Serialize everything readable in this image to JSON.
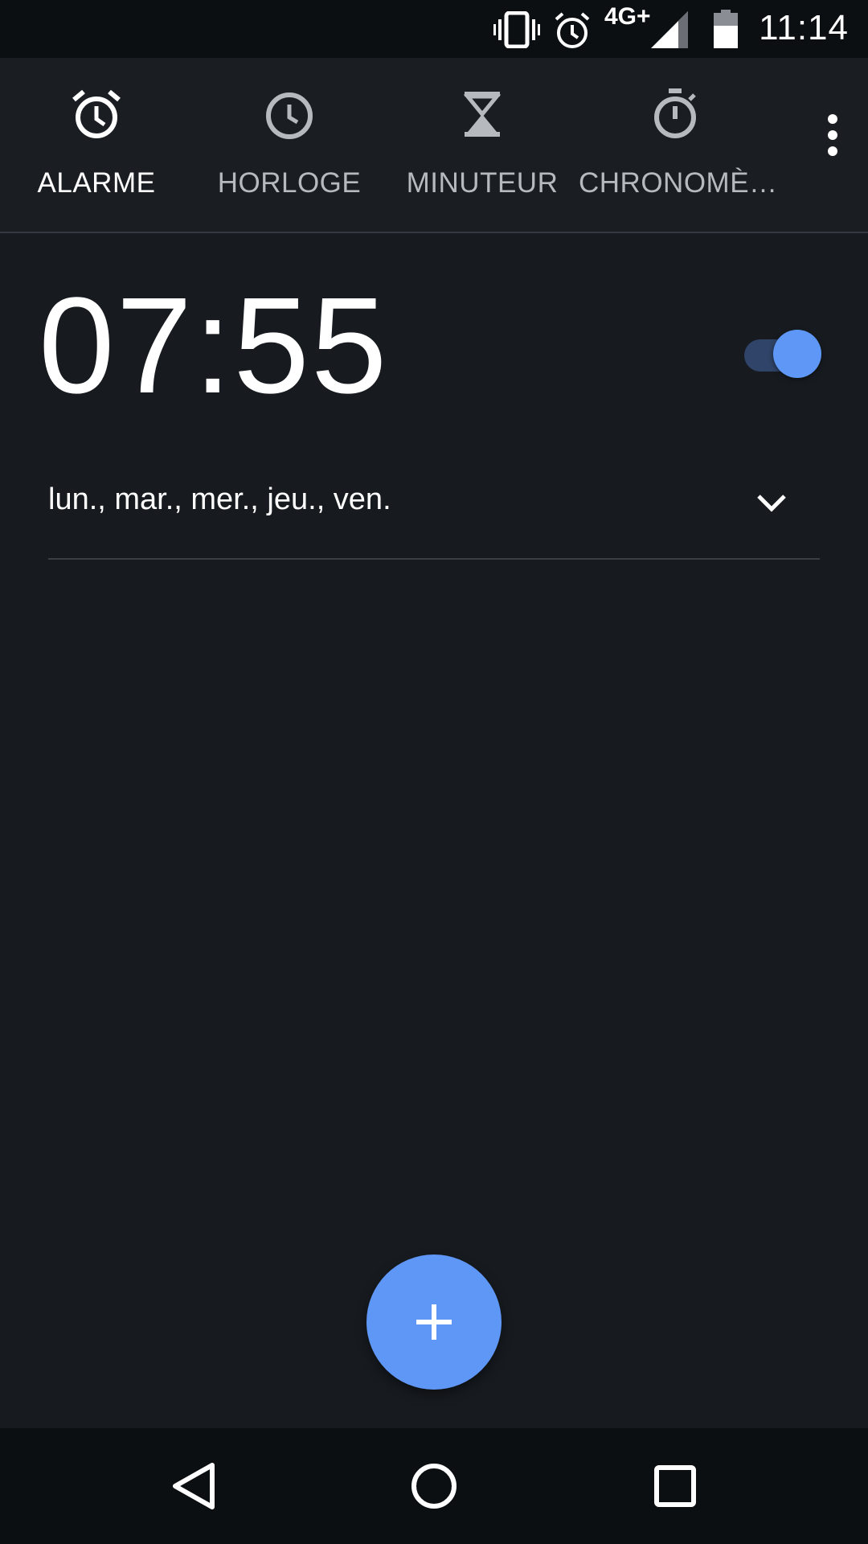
{
  "status_bar": {
    "network": "4G+",
    "time": "11:14",
    "icons": [
      "vibrate-icon",
      "alarm-icon",
      "signal-icon",
      "battery-icon"
    ]
  },
  "tabs": [
    {
      "label": "ALARME",
      "icon": "alarm-clock-icon",
      "active": true
    },
    {
      "label": "HORLOGE",
      "icon": "clock-icon",
      "active": false
    },
    {
      "label": "MINUTEUR",
      "icon": "hourglass-icon",
      "active": false
    },
    {
      "label": "CHRONOMÈ…",
      "icon": "stopwatch-icon",
      "active": false
    }
  ],
  "overflow_icon": "more-vert-icon",
  "alarm": {
    "time": "07:55",
    "enabled": true,
    "days": "lun., mar., mer., jeu., ven."
  },
  "fab_icon": "plus-icon",
  "nav": [
    "back-icon",
    "home-icon",
    "recents-icon"
  ],
  "colors": {
    "background": "#171b20",
    "accent": "#5e97f6",
    "toggle_track": "#2f4468",
    "inactive_text": "#b6babf"
  }
}
